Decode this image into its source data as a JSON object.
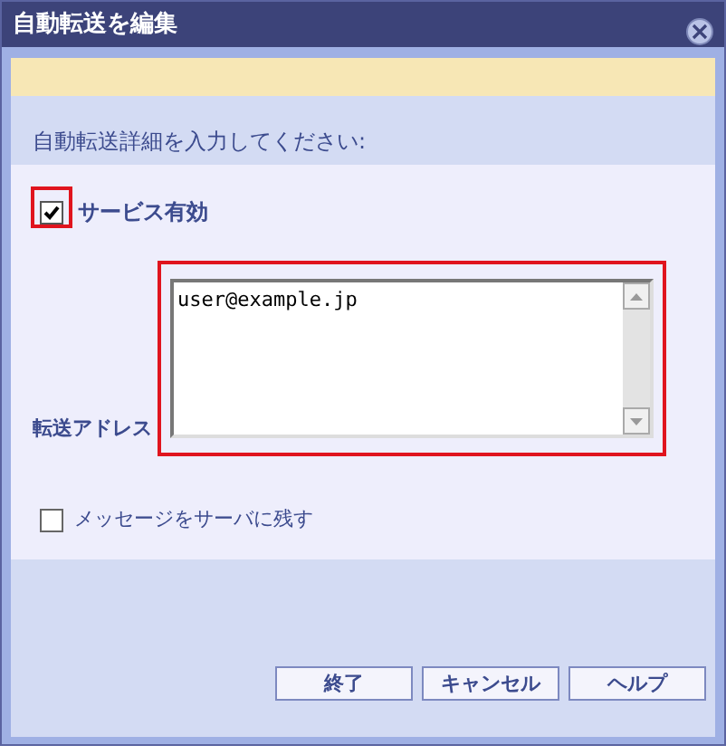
{
  "window": {
    "title": "自動転送を編集"
  },
  "section_header": "自動転送詳細を入力してください:",
  "service_enabled": {
    "label": "サービス有効",
    "checked": true
  },
  "forward_address": {
    "label": "転送アドレス",
    "value": "user@example.jp"
  },
  "keep_on_server": {
    "label": "メッセージをサーバに残す",
    "checked": false
  },
  "buttons": [
    "終了",
    "キャンセル",
    "ヘルプ"
  ]
}
